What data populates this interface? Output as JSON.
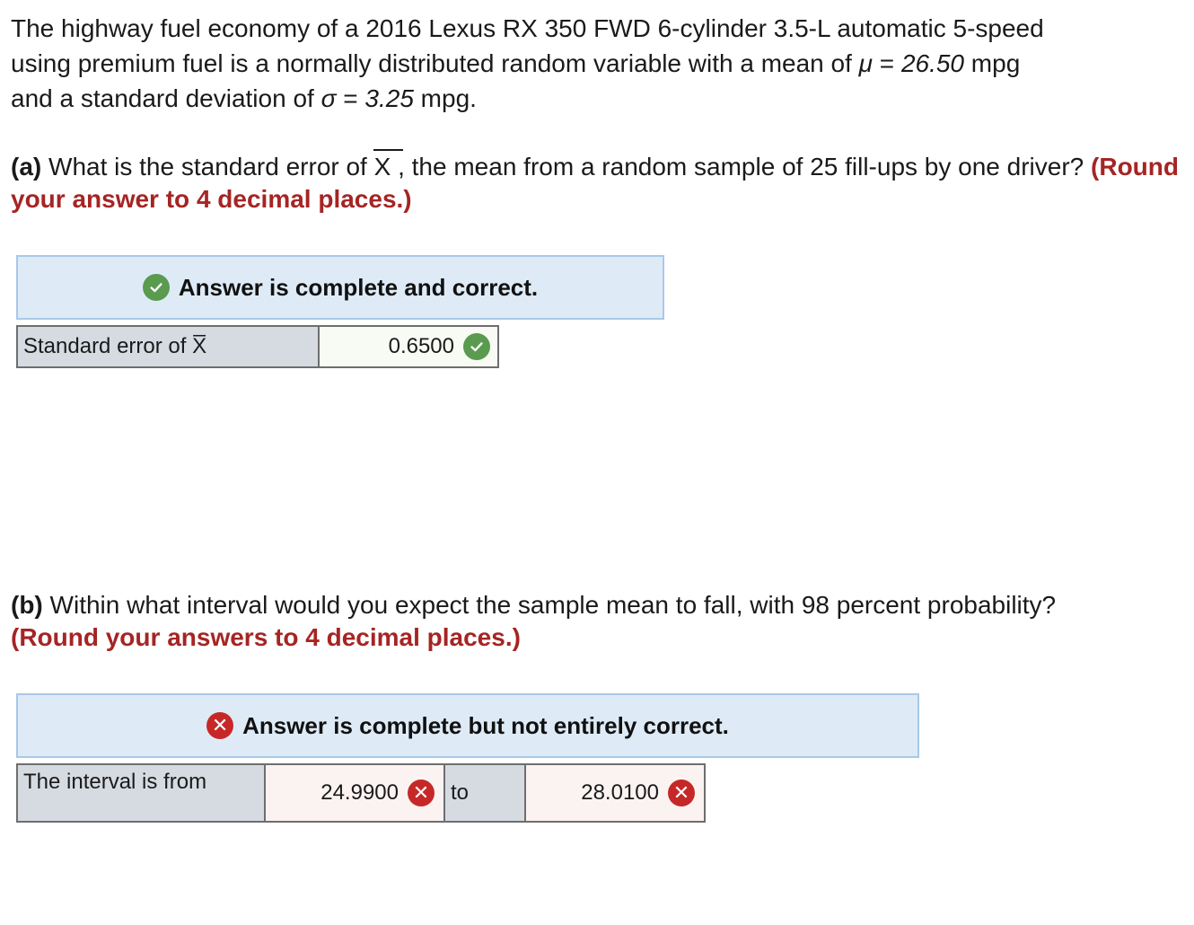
{
  "intro": {
    "line1": "The highway fuel economy of a 2016 Lexus RX 350 FWD 6-cylinder 3.5-L automatic 5-speed",
    "line2_pre": "using premium fuel is a normally distributed random variable with a mean of ",
    "mu_symbol": "μ",
    "equals": " = ",
    "mu_value": "26.50",
    "mpg_unit": " mpg",
    "line3_pre": "and a standard deviation of ",
    "sigma_symbol": "σ",
    "sigma_value": "3.25",
    "mpg_unit_end": " mpg."
  },
  "part_a": {
    "tag": "(a)",
    "question_pre": " What is the standard error of ",
    "xbar": "X",
    "question_post": " , the mean from a random sample of 25 fill-ups by one driver? ",
    "instruction": "(Round your answer to 4 decimal places.)",
    "banner": "Answer is complete and correct.",
    "row_label": "Standard error of X̅",
    "answer": "0.6500"
  },
  "part_b": {
    "tag": "(b)",
    "question": " Within what interval would you expect the sample mean to fall, with 98 percent probability?",
    "instruction": "(Round your answers to 4 decimal places.)",
    "banner": "Answer is complete but not entirely correct.",
    "row_label": "The interval is from",
    "lower": "24.9900",
    "to_label": "to",
    "upper": "28.0100"
  },
  "icons": {
    "correct": "check-circle-icon",
    "incorrect": "x-circle-icon"
  },
  "colors": {
    "instruction_red": "#a52524",
    "correct_green": "#5a9b4f",
    "incorrect_red": "#c62828",
    "banner_bg": "#deebf7",
    "label_bg": "#d6dbe2"
  }
}
